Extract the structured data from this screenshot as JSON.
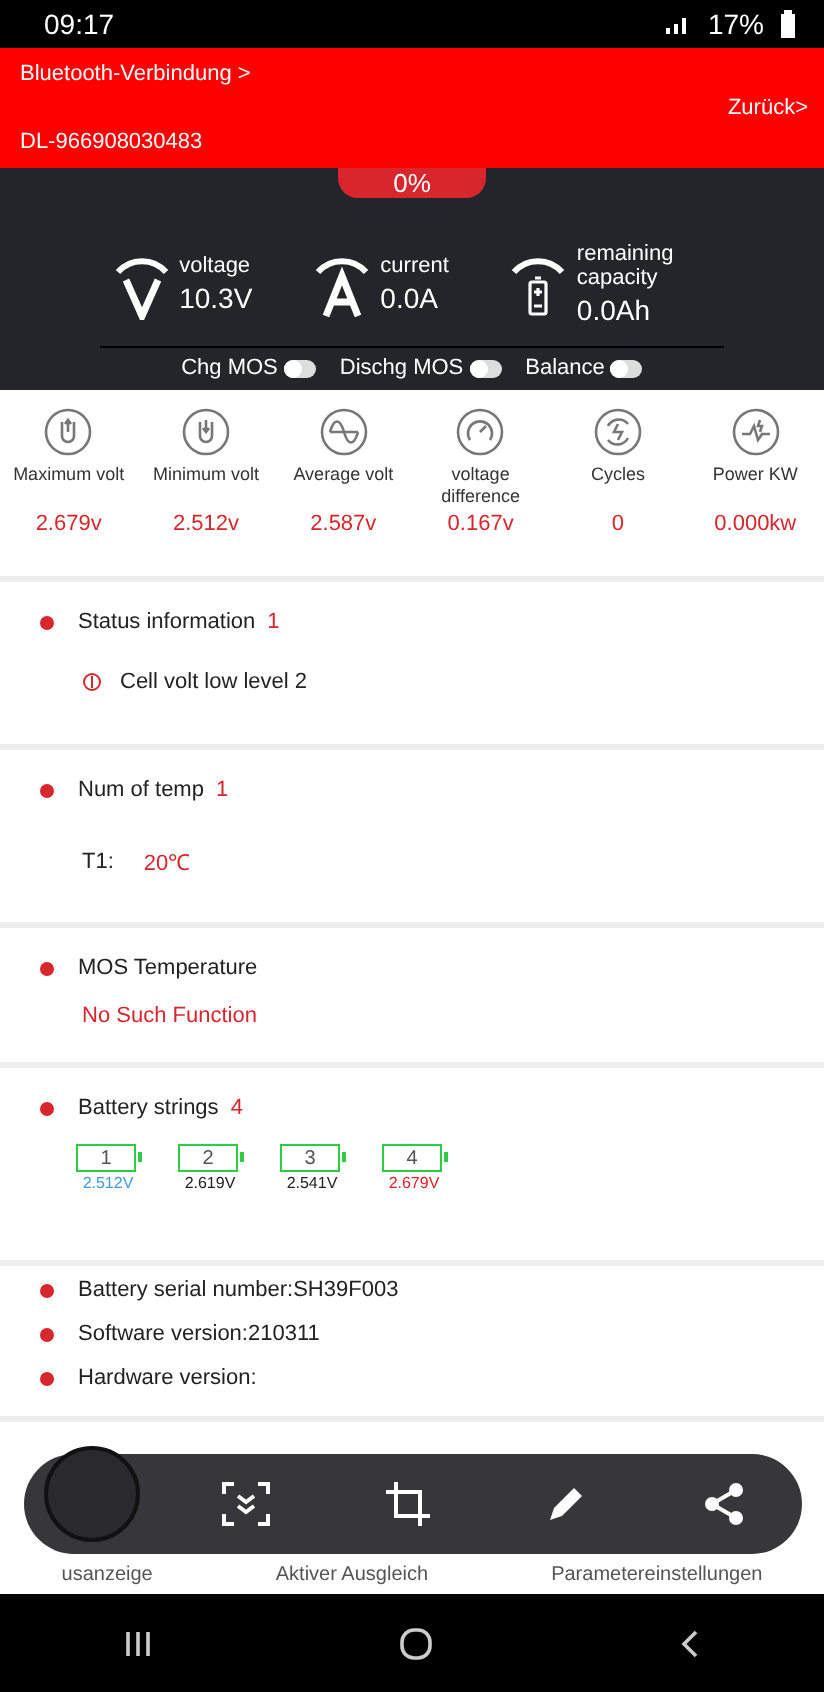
{
  "status_bar": {
    "time": "09:17",
    "battery": "17%"
  },
  "header": {
    "connection": "Bluetooth-Verbindung",
    "connection_arrow": ">",
    "device": "DL-966908030483",
    "back": "Zurück>"
  },
  "soc": {
    "reading": "0%"
  },
  "gauges": [
    {
      "kind": "voltage",
      "label": "voltage",
      "value": "10.3V"
    },
    {
      "kind": "current",
      "label": "current",
      "value": "0.0A"
    },
    {
      "kind": "capacity",
      "label": "remaining capacity",
      "value": "0.0Ah"
    }
  ],
  "switches": [
    {
      "label": "Chg MOS",
      "on": false
    },
    {
      "label": "Dischg MOS",
      "on": false
    },
    {
      "label": "Balance",
      "on": false
    }
  ],
  "stats": [
    {
      "kind": "max",
      "label": "Maximum volt",
      "value": "2.679v"
    },
    {
      "kind": "min",
      "label": "Minimum volt",
      "value": "2.512v"
    },
    {
      "kind": "avg",
      "label": "Average volt",
      "value": "2.587v"
    },
    {
      "kind": "diff",
      "label": "voltage difference",
      "value": "0.167v"
    },
    {
      "kind": "cycles",
      "label": "Cycles",
      "value": "0"
    },
    {
      "kind": "power",
      "label": "Power KW",
      "value": "0.000kw"
    }
  ],
  "status_information": {
    "title": "Status information",
    "count": "1",
    "alarms": [
      "Cell volt low level 2"
    ]
  },
  "temperatures": {
    "title": "Num of temp",
    "count": "1",
    "items": [
      {
        "label": "T1:",
        "value": "20℃"
      }
    ]
  },
  "mos_temperature": {
    "title": "MOS Temperature",
    "value": "No Such Function"
  },
  "battery_strings": {
    "title": "Battery strings",
    "count": "4",
    "cells": [
      {
        "number": "1",
        "voltage": "2.512V",
        "color": "#3a9be0"
      },
      {
        "number": "2",
        "voltage": "2.619V",
        "color": "#222222"
      },
      {
        "number": "3",
        "voltage": "2.541V",
        "color": "#222222"
      },
      {
        "number": "4",
        "voltage": "2.679V",
        "color": "#e0202a"
      }
    ]
  },
  "info": [
    "Battery serial number:SH39F003",
    "Software version:210311",
    "Hardware version:"
  ],
  "bottom_nav": [
    {
      "label": "usanzeige"
    },
    {
      "label": "Aktiver Ausgleich"
    },
    {
      "label": "Parametereinstellungen"
    }
  ]
}
